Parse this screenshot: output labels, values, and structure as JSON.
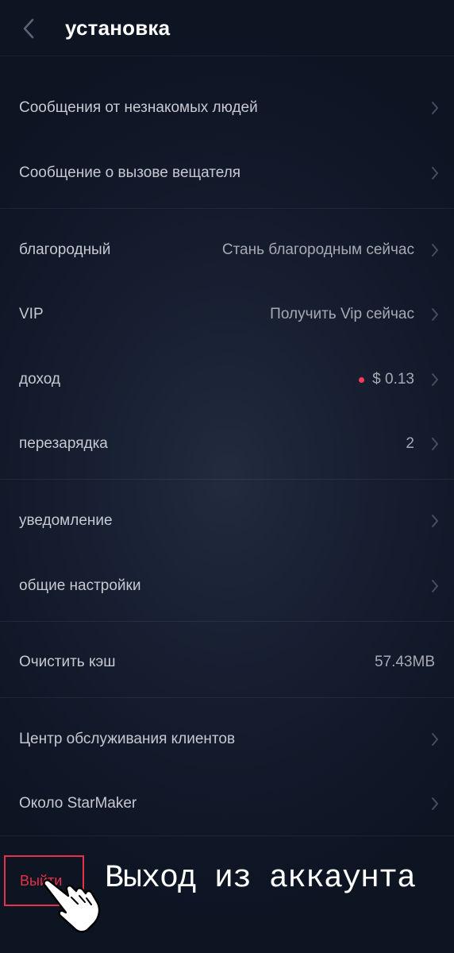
{
  "header": {
    "title": "установка",
    "back_icon": "chevron-left-icon"
  },
  "settings": {
    "strangers_messages": {
      "label": "Сообщения от незнакомых людей"
    },
    "host_call_message": {
      "label": "Сообщение о вызове вещателя"
    },
    "noble": {
      "label": "благородный",
      "value": "Стань благородным сейчас"
    },
    "vip": {
      "label": "VIP",
      "value": "Получить Vip сейчас"
    },
    "income": {
      "label": "доход",
      "value": "$ 0.13",
      "dot_color": "#ff3b5c"
    },
    "recharge": {
      "label": "перезарядка",
      "value": "2"
    },
    "notifications": {
      "label": "уведомление"
    },
    "general_settings": {
      "label": "общие настройки"
    },
    "clear_cache": {
      "label": "Очистить кэш",
      "value": "57.43MB"
    },
    "customer_service": {
      "label": "Центр обслуживания клиентов"
    },
    "about": {
      "label": "Около StarMaker"
    }
  },
  "logout": {
    "label": "Выйти",
    "highlight_color": "#e8304a"
  },
  "annotation": {
    "text": "Выход из аккаунта",
    "pointer_icon": "hand-pointer-icon"
  },
  "colors": {
    "background": "#151d2f",
    "label": "#c6c9d1",
    "value": "#a7aab3",
    "accent_red": "#e8304a"
  }
}
